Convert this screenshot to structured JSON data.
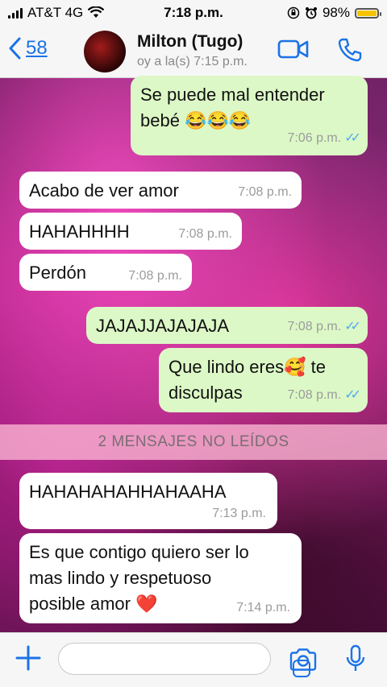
{
  "status_bar": {
    "carrier": "AT&T 4G",
    "time": "7:18 p.m.",
    "battery": "98%",
    "battery_level": 0.98
  },
  "header": {
    "back_count": "58",
    "contact_name": "Milton (Tugo)",
    "last_seen": "oy a la(s) 7:15 p.m."
  },
  "messages": [
    {
      "direction": "out",
      "text_line1": "Se puede mal entender",
      "text_line2": "bebé 😂😂😂",
      "time": "7:06 p.m."
    },
    {
      "direction": "in",
      "text": "Acabo de ver amor",
      "time": "7:08 p.m."
    },
    {
      "direction": "in",
      "text": "HAHAHHHH",
      "time": "7:08 p.m."
    },
    {
      "direction": "in",
      "text": "Perdón",
      "time": "7:08 p.m."
    },
    {
      "direction": "out",
      "text": "JAJAJJAJAJAJA",
      "time": "7:08 p.m."
    },
    {
      "direction": "out",
      "text_line1": "Que lindo eres🥰 te",
      "text_line2": "disculpas",
      "time": "7:08 p.m."
    },
    {
      "direction": "in",
      "text": "HAHAHAHAHHAHAAHA",
      "time": "7:13 p.m."
    },
    {
      "direction": "in",
      "text_line1": "Es que contigo quiero ser lo",
      "text_line2": "mas lindo y respetuoso",
      "text_line3": "posible amor ❤️",
      "time": "7:14 p.m."
    }
  ],
  "unread_banner": "2 MENSAJES NO LEÍDOS",
  "ticks": "✓✓",
  "icons": {
    "back": "chevron-left-icon",
    "video": "video-camera-icon",
    "phone": "phone-icon",
    "plus": "plus-icon",
    "sticker": "sticker-icon",
    "camera": "camera-icon",
    "mic": "microphone-icon",
    "wifi": "wifi-icon",
    "signal": "signal-icon",
    "lock": "orientation-lock-icon",
    "alarm": "alarm-icon"
  },
  "colors": {
    "accent": "#1a73e8",
    "outgoing": "#dcf8c6",
    "incoming": "#ffffff",
    "read_ticks": "#4fa9f5"
  }
}
